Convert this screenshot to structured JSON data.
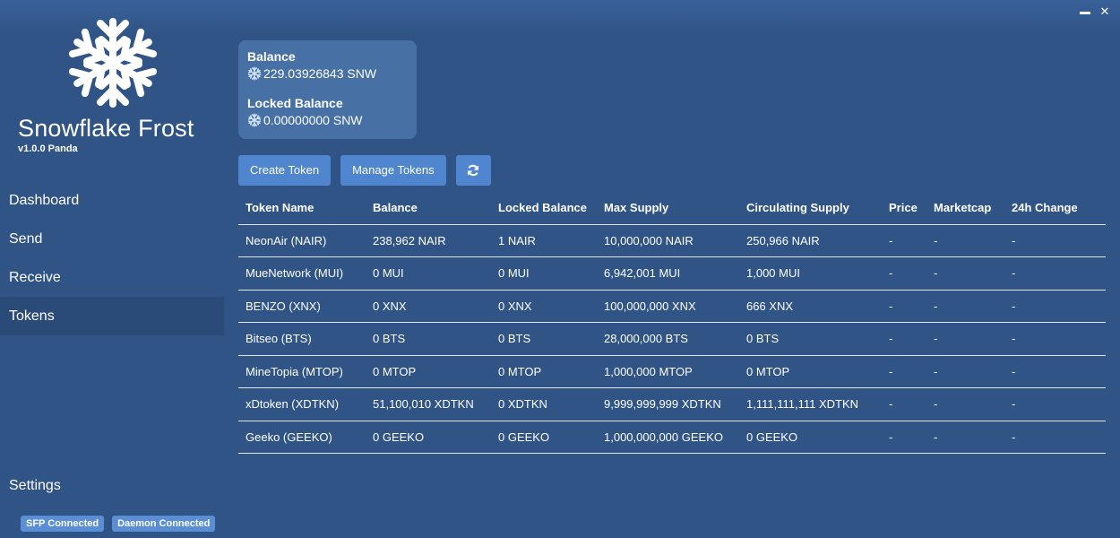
{
  "app": {
    "title": "Snowflake Frost",
    "version": "v1.0.0 Panda",
    "logo": "snowflake-icon"
  },
  "window": {
    "minimize_icon": "minimize-icon",
    "close_icon": "close-icon",
    "close_label": "✕"
  },
  "sidebar": {
    "items": [
      {
        "label": "Dashboard"
      },
      {
        "label": "Send"
      },
      {
        "label": "Receive"
      },
      {
        "label": "Tokens",
        "active": true
      }
    ],
    "settings_label": "Settings",
    "status": {
      "sfp": "SFP Connected",
      "daemon": "Daemon Connected"
    }
  },
  "balance": {
    "label": "Balance",
    "value": "229.03926843 SNW",
    "locked_label": "Locked Balance",
    "locked_value": "0.00000000 SNW"
  },
  "toolbar": {
    "create_label": "Create Token",
    "manage_label": "Manage Tokens",
    "refresh_icon": "refresh-icon"
  },
  "table": {
    "headers": [
      "Token Name",
      "Balance",
      "Locked Balance",
      "Max Supply",
      "Circulating Supply",
      "Price",
      "Marketcap",
      "24h Change"
    ],
    "rows": [
      [
        "NeonAir (NAIR)",
        "238,962 NAIR",
        "1 NAIR",
        "10,000,000 NAIR",
        "250,966 NAIR",
        "-",
        "-",
        "-"
      ],
      [
        "MueNetwork (MUI)",
        "0 MUI",
        "0 MUI",
        "6,942,001 MUI",
        "1,000 MUI",
        "-",
        "-",
        "-"
      ],
      [
        "BENZO (XNX)",
        "0 XNX",
        "0 XNX",
        "100,000,000 XNX",
        "666 XNX",
        "-",
        "-",
        "-"
      ],
      [
        "Bitseo (BTS)",
        "0 BTS",
        "0 BTS",
        "28,000,000 BTS",
        "0 BTS",
        "-",
        "-",
        "-"
      ],
      [
        "MineTopia (MTOP)",
        "0 MTOP",
        "0 MTOP",
        "1,000,000 MTOP",
        "0 MTOP",
        "-",
        "-",
        "-"
      ],
      [
        "xDtoken (XDTKN)",
        "51,100,010 XDTKN",
        "0 XDTKN",
        "9,999,999,999 XDTKN",
        "1,111,111,111 XDTKN",
        "-",
        "-",
        "-"
      ],
      [
        "Geeko (GEEKO)",
        "0 GEEKO",
        "0 GEEKO",
        "1,000,000,000 GEEKO",
        "0 GEEKO",
        "-",
        "-",
        "-"
      ]
    ]
  },
  "colors": {
    "background": "#2f5485",
    "active_nav": "#2a4b77",
    "card": "#4770a5",
    "button": "#4f86cf",
    "badge": "#5a8fd6"
  }
}
